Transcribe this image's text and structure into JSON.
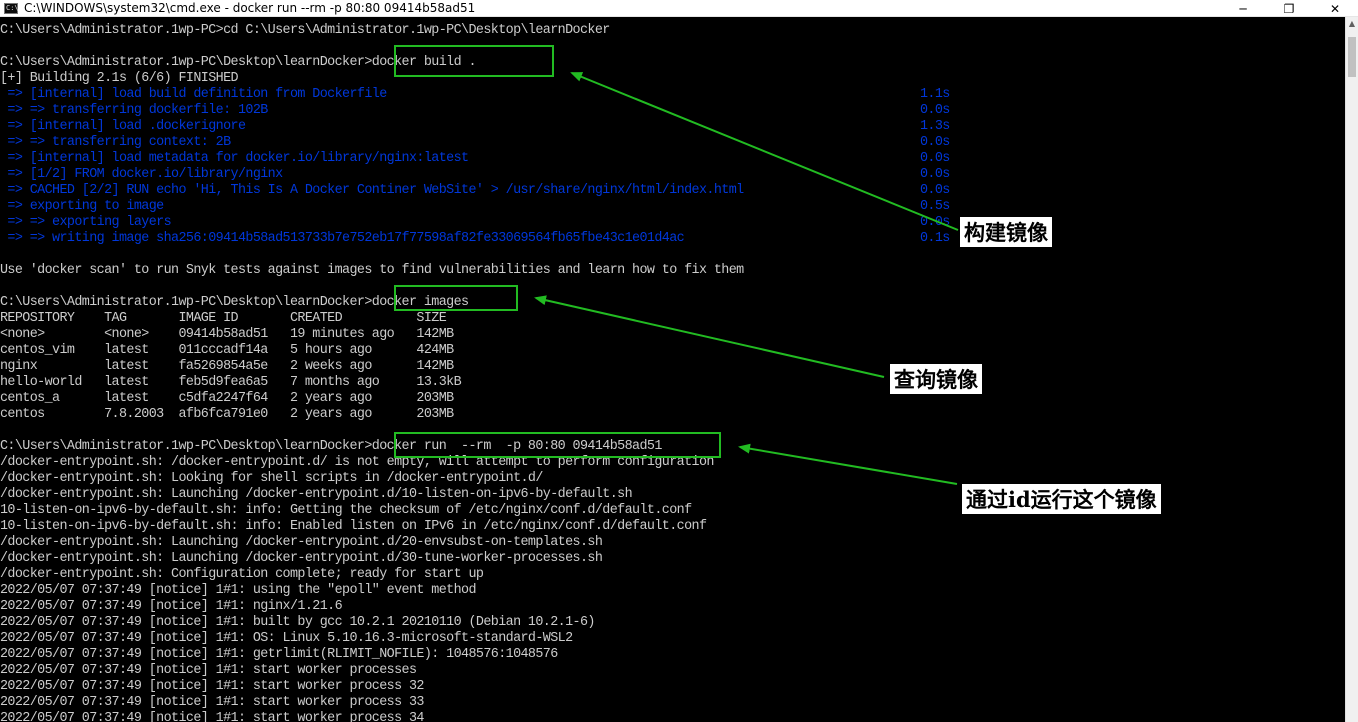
{
  "window": {
    "title": "C:\\WINDOWS\\system32\\cmd.exe - docker  run  --rm  -p 80:80 09414b58ad51",
    "icon_name": "cmd-icon",
    "minimize_glyph": "─",
    "maximize_glyph": "❐",
    "close_glyph": "✕"
  },
  "colors": {
    "console_bg": "#000000",
    "console_text": "#cccccc",
    "build_log_blue": "#0037da",
    "highlight_green": "#22bb22"
  },
  "console": {
    "lines": [
      {
        "text": "C:\\Users\\Administrator.1wp-PC>cd C:\\Users\\Administrator.1wp-PC\\Desktop\\learnDocker"
      },
      {
        "text": ""
      },
      {
        "text": "C:\\Users\\Administrator.1wp-PC\\Desktop\\learnDocker>docker build ."
      },
      {
        "text": "[+] Building 2.1s (6/6) FINISHED"
      },
      {
        "text": " => [internal] load build definition from Dockerfile",
        "time": "1.1s",
        "style": "blue"
      },
      {
        "text": " => => transferring dockerfile: 102B",
        "time": "0.0s",
        "style": "blue"
      },
      {
        "text": " => [internal] load .dockerignore",
        "time": "1.3s",
        "style": "blue"
      },
      {
        "text": " => => transferring context: 2B",
        "time": "0.0s",
        "style": "blue"
      },
      {
        "text": " => [internal] load metadata for docker.io/library/nginx:latest",
        "time": "0.0s",
        "style": "blue"
      },
      {
        "text": " => [1/2] FROM docker.io/library/nginx",
        "time": "0.0s",
        "style": "blue"
      },
      {
        "text": " => CACHED [2/2] RUN echo 'Hi, This Is A Docker Continer WebSite' > /usr/share/nginx/html/index.html",
        "time": "0.0s",
        "style": "blue"
      },
      {
        "text": " => exporting to image",
        "time": "0.5s",
        "style": "blue"
      },
      {
        "text": " => => exporting layers",
        "time": "0.0s",
        "style": "blue"
      },
      {
        "text": " => => writing image sha256:09414b58ad513733b7e752eb17f77598af82fe33069564fb65fbe43c1e01d4ac",
        "time": "0.1s",
        "style": "blue"
      },
      {
        "text": ""
      },
      {
        "text": "Use 'docker scan' to run Snyk tests against images to find vulnerabilities and learn how to fix them"
      },
      {
        "text": ""
      },
      {
        "text": "C:\\Users\\Administrator.1wp-PC\\Desktop\\learnDocker>docker images"
      },
      {
        "text": "REPOSITORY    TAG       IMAGE ID       CREATED          SIZE"
      },
      {
        "text": "<none>        <none>    09414b58ad51   19 minutes ago   142MB"
      },
      {
        "text": "centos_vim    latest    011cccadf14a   5 hours ago      424MB"
      },
      {
        "text": "nginx         latest    fa5269854a5e   2 weeks ago      142MB"
      },
      {
        "text": "hello-world   latest    feb5d9fea6a5   7 months ago     13.3kB"
      },
      {
        "text": "centos_a      latest    c5dfa2247f64   2 years ago      203MB"
      },
      {
        "text": "centos        7.8.2003  afb6fca791e0   2 years ago      203MB"
      },
      {
        "text": ""
      },
      {
        "text": "C:\\Users\\Administrator.1wp-PC\\Desktop\\learnDocker>docker run  --rm  -p 80:80 09414b58ad51"
      },
      {
        "text": "/docker-entrypoint.sh: /docker-entrypoint.d/ is not empty, will attempt to perform configuration"
      },
      {
        "text": "/docker-entrypoint.sh: Looking for shell scripts in /docker-entrypoint.d/"
      },
      {
        "text": "/docker-entrypoint.sh: Launching /docker-entrypoint.d/10-listen-on-ipv6-by-default.sh"
      },
      {
        "text": "10-listen-on-ipv6-by-default.sh: info: Getting the checksum of /etc/nginx/conf.d/default.conf"
      },
      {
        "text": "10-listen-on-ipv6-by-default.sh: info: Enabled listen on IPv6 in /etc/nginx/conf.d/default.conf"
      },
      {
        "text": "/docker-entrypoint.sh: Launching /docker-entrypoint.d/20-envsubst-on-templates.sh"
      },
      {
        "text": "/docker-entrypoint.sh: Launching /docker-entrypoint.d/30-tune-worker-processes.sh"
      },
      {
        "text": "/docker-entrypoint.sh: Configuration complete; ready for start up"
      },
      {
        "text": "2022/05/07 07:37:49 [notice] 1#1: using the \"epoll\" event method"
      },
      {
        "text": "2022/05/07 07:37:49 [notice] 1#1: nginx/1.21.6"
      },
      {
        "text": "2022/05/07 07:37:49 [notice] 1#1: built by gcc 10.2.1 20210110 (Debian 10.2.1-6)"
      },
      {
        "text": "2022/05/07 07:37:49 [notice] 1#1: OS: Linux 5.10.16.3-microsoft-standard-WSL2"
      },
      {
        "text": "2022/05/07 07:37:49 [notice] 1#1: getrlimit(RLIMIT_NOFILE): 1048576:1048576"
      },
      {
        "text": "2022/05/07 07:37:49 [notice] 1#1: start worker processes"
      },
      {
        "text": "2022/05/07 07:37:49 [notice] 1#1: start worker process 32"
      },
      {
        "text": "2022/05/07 07:37:49 [notice] 1#1: start worker process 33"
      },
      {
        "text": "2022/05/07 07:37:49 [notice] 1#1: start worker process 34"
      }
    ]
  },
  "annotations": {
    "build": "构建镜像",
    "images": "查询镜像",
    "run": "通过id运行这个镜像"
  }
}
